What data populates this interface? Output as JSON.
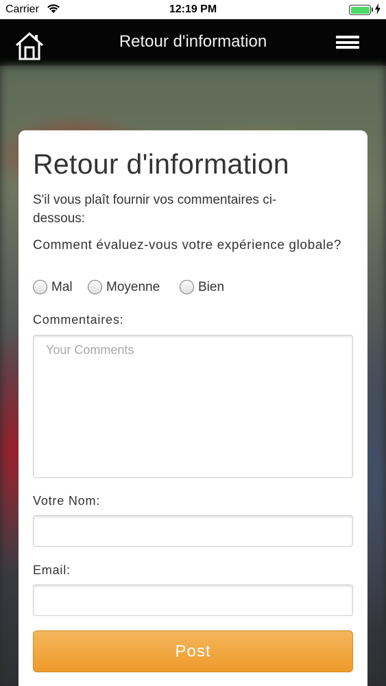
{
  "status_bar": {
    "carrier": "Carrier",
    "time": "12:19 PM",
    "battery_level": 1.0,
    "battery_color": "#4cd964"
  },
  "nav": {
    "title": "Retour d'information",
    "home_icon": "home-icon",
    "menu_icon": "hamburger-menu-icon"
  },
  "form": {
    "heading": "Retour d'information",
    "intro": "S'il vous plaît fournir vos commentaires ci-dessous:",
    "question": "Comment évaluez-vous votre expérience globale?",
    "rating_options": [
      {
        "label": "Mal",
        "selected": false
      },
      {
        "label": "Moyenne",
        "selected": false
      },
      {
        "label": "Bien",
        "selected": false
      }
    ],
    "comments_label": "Commentaires:",
    "comments_placeholder": "Your Comments",
    "comments_value": "",
    "name_label": "Votre Nom:",
    "name_value": "",
    "email_label": "Email:",
    "email_value": "",
    "submit_label": "Post",
    "submit_color": "#ee9a2a"
  }
}
